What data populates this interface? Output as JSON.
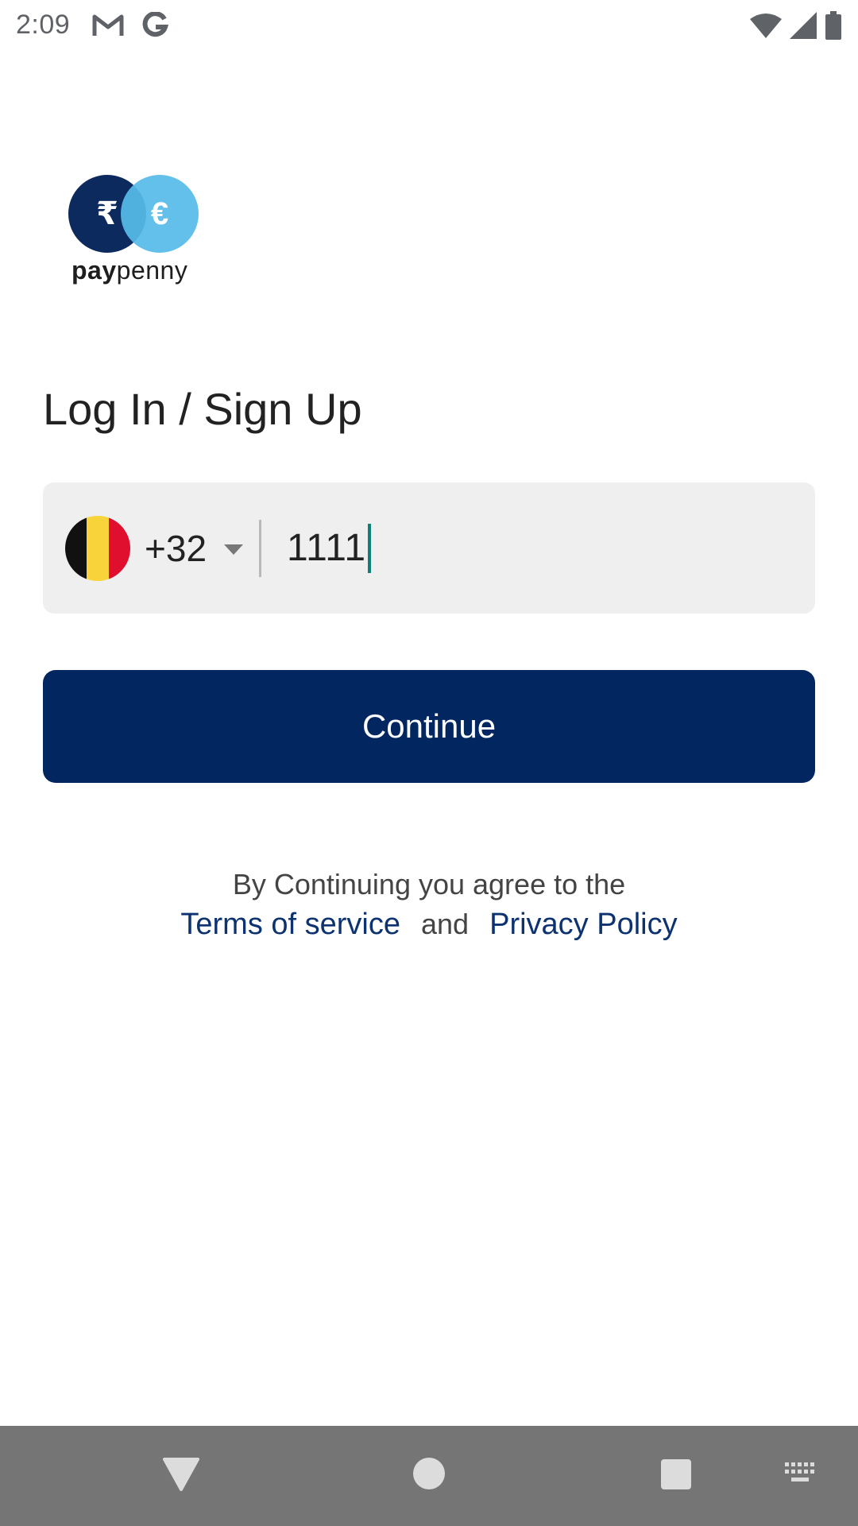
{
  "status_bar": {
    "time": "2:09",
    "left_icons": [
      "gmail-icon",
      "google-icon"
    ],
    "right_icons": [
      "wifi-icon",
      "signal-icon",
      "battery-icon"
    ]
  },
  "logo": {
    "symbol_left": "₹",
    "symbol_right": "€",
    "text_bold": "pay",
    "text_regular": "penny"
  },
  "page": {
    "title": "Log In / Sign Up"
  },
  "phone_input": {
    "country_flag": "belgium-flag",
    "country_code": "+32",
    "value": "1111"
  },
  "continue_button": {
    "label": "Continue"
  },
  "agreement": {
    "text": "By Continuing you agree to the",
    "terms_link": "Terms of service",
    "and": "and",
    "privacy_link": "Privacy Policy"
  },
  "colors": {
    "primary": "#012660",
    "logo_light": "#56bbea",
    "cursor": "#0e7f74",
    "field_bg": "#efefef",
    "nav_bar": "#757575"
  },
  "nav_bar": {
    "buttons": [
      "back-icon",
      "home-icon",
      "recents-icon",
      "keyboard-icon"
    ]
  }
}
